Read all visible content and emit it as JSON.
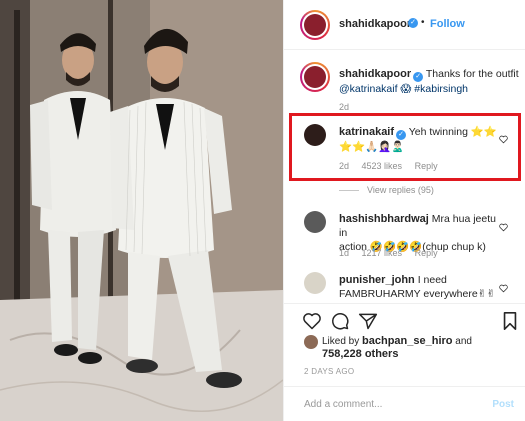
{
  "post": {
    "username": "shahidkapoor",
    "separator": "•",
    "follow_label": "Follow"
  },
  "caption": {
    "username": "shahidkapoor",
    "text_line1": "Thanks for the outfit",
    "text_line2": "@katrinakaif 😱 #kabirsingh",
    "age": "2d"
  },
  "comments": [
    {
      "username": "katrinakaif",
      "text_line1": "Yeh twinning ⭐⭐",
      "text_line2": "⭐⭐🙏🏻🤦🏻‍♀️🙎🏻‍♂️",
      "age": "2d",
      "likes": "4523 likes",
      "reply_label": "Reply",
      "view_replies": "View replies (95)"
    },
    {
      "username": "hashishbhardwaj",
      "text_line1": "Mra hua jeetu in",
      "text_line2": "action 🤣🤣🤣🤣(chup chup k)",
      "age": "1d",
      "likes": "1217 likes",
      "reply_label": "Reply"
    },
    {
      "username": "punisher_john",
      "text_line1": "I need",
      "text_line2": "FAMBRUHARMY everywhere✌✌"
    }
  ],
  "likes": {
    "liked_by_prefix": "Liked by",
    "liked_by_user": "bachpan_se_hiro",
    "and_label": "and",
    "others": "758,228 others"
  },
  "date": "2 DAYS AGO",
  "add_comment": {
    "placeholder": "Add a comment...",
    "post_label": "Post"
  },
  "colors": {
    "accent": "#3897f0",
    "highlight_box": "#e0181f"
  }
}
